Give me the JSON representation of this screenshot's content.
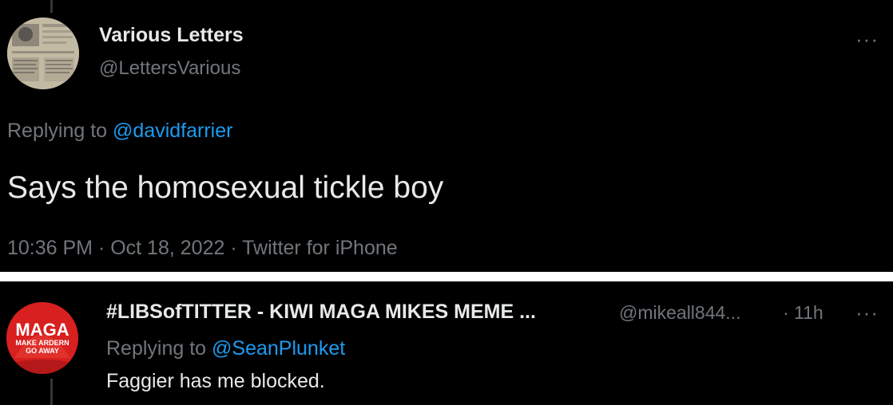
{
  "tweet1": {
    "display_name": "Various Letters",
    "handle": "@LettersVarious",
    "more_label": "···",
    "replying_prefix": "Replying to ",
    "replying_to": "@davidfarrier",
    "text": "Says the homosexual tickle boy",
    "meta": "10:36 PM · Oct 18, 2022 · Twitter for iPhone"
  },
  "tweet2": {
    "display_name": "#LIBSofTITTER - KIWI MAGA MIKES MEME ...",
    "handle": "@mikeall844...",
    "time": "· 11h",
    "more_label": "···",
    "replying_prefix": "Replying to ",
    "replying_to": "@SeanPlunket",
    "text": "Faggier has me blocked.",
    "avatar_line1": "MAGA",
    "avatar_line2": "MAKE ARDERN",
    "avatar_line3": "GO AWAY"
  },
  "colors": {
    "background": "#000000",
    "text": "#e7e9ea",
    "muted": "#71767b",
    "link": "#1d9bf0",
    "divider": "#ffffff",
    "maga_red": "#d7201f"
  },
  "icons": {
    "more": "more-options-icon"
  }
}
